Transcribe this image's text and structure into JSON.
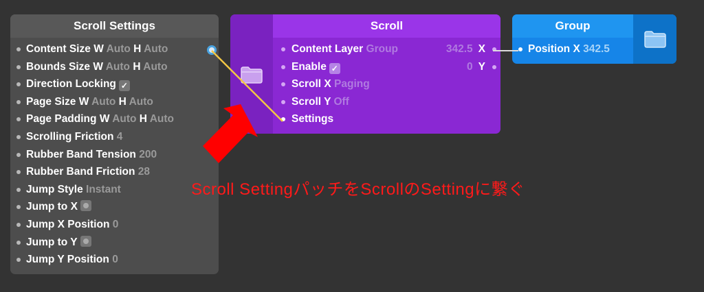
{
  "scroll_settings": {
    "title": "Scroll Settings",
    "rows": [
      {
        "label": "Content Size",
        "v1k": "W",
        "v1": "Auto",
        "v2k": "H",
        "v2": "Auto"
      },
      {
        "label": "Bounds Size",
        "v1k": "W",
        "v1": "Auto",
        "v2k": "H",
        "v2": "Auto"
      },
      {
        "label": "Direction Locking",
        "check": "✓"
      },
      {
        "label": "Page Size",
        "v1k": "W",
        "v1": "Auto",
        "v2k": "H",
        "v2": "Auto"
      },
      {
        "label": "Page Padding",
        "v1k": "W",
        "v1": "Auto",
        "v2k": "H",
        "v2": "Auto"
      },
      {
        "label": "Scrolling Friction",
        "v1": "4"
      },
      {
        "label": "Rubber Band Tension",
        "v1": "200"
      },
      {
        "label": "Rubber Band Friction",
        "v1": "28"
      },
      {
        "label": "Jump Style",
        "v1": "Instant"
      },
      {
        "label": "Jump to X",
        "pulse": true
      },
      {
        "label": "Jump X Position",
        "v1": "0"
      },
      {
        "label": "Jump to Y",
        "pulse": true
      },
      {
        "label": "Jump Y Position",
        "v1": "0"
      }
    ]
  },
  "scroll": {
    "title": "Scroll",
    "rows": [
      {
        "label": "Content Layer",
        "v1": "Group",
        "out_value": "342.5",
        "out_label": "X"
      },
      {
        "label": "Enable",
        "check": "✓",
        "out_value": "0",
        "out_label": "Y"
      },
      {
        "label": "Scroll X",
        "v1": "Paging"
      },
      {
        "label": "Scroll Y",
        "v1": "Off"
      },
      {
        "label": "Settings"
      }
    ]
  },
  "group": {
    "title": "Group",
    "rows": [
      {
        "label": "Position X",
        "v1": "342.5"
      }
    ]
  },
  "annotation": "Scroll SettingパッチをScrollのSettingに繋ぐ",
  "colors": {
    "background": "#333333",
    "scroll_settings": "#4d4d4d",
    "scroll": "#8a28d3",
    "group": "#1685e8",
    "cable": "#f2c744",
    "arrow": "#ff0000"
  }
}
